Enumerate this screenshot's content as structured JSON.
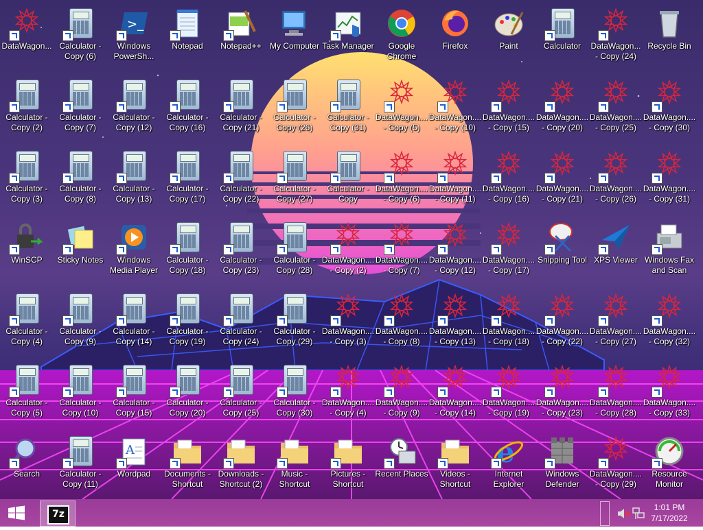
{
  "desktop": {
    "icons": [
      {
        "label": "DataWagon...",
        "type": "star"
      },
      {
        "label": "Calculator - Copy (6)",
        "type": "calc"
      },
      {
        "label": "Windows PowerSh...",
        "type": "powershell"
      },
      {
        "label": "Notepad",
        "type": "notepad"
      },
      {
        "label": "Notepad++",
        "type": "notepadpp"
      },
      {
        "label": "My Computer",
        "type": "computer"
      },
      {
        "label": "Task Manager",
        "type": "taskmgr"
      },
      {
        "label": "Google Chrome",
        "type": "chrome"
      },
      {
        "label": "Firefox",
        "type": "firefox"
      },
      {
        "label": "Paint",
        "type": "paint"
      },
      {
        "label": "Calculator",
        "type": "calc"
      },
      {
        "label": "DataWagon... - Copy (24)",
        "type": "star"
      },
      {
        "label": "Recycle Bin",
        "type": "recycle"
      },
      {
        "label": "Calculator - Copy (2)",
        "type": "calc"
      },
      {
        "label": "Calculator - Copy (7)",
        "type": "calc"
      },
      {
        "label": "Calculator - Copy (12)",
        "type": "calc"
      },
      {
        "label": "Calculator - Copy (16)",
        "type": "calc"
      },
      {
        "label": "Calculator - Copy (21)",
        "type": "calc"
      },
      {
        "label": "Calculator - Copy (26)",
        "type": "calc"
      },
      {
        "label": "Calculator - Copy (31)",
        "type": "calc"
      },
      {
        "label": "DataWagon.... - Copy (5)",
        "type": "star"
      },
      {
        "label": "DataWagon.... - Copy (10)",
        "type": "star"
      },
      {
        "label": "DataWagon.... - Copy (15)",
        "type": "star"
      },
      {
        "label": "DataWagon.... - Copy (20)",
        "type": "star"
      },
      {
        "label": "DataWagon.... - Copy (25)",
        "type": "star"
      },
      {
        "label": "DataWagon.... - Copy (30)",
        "type": "star"
      },
      {
        "label": "Calculator - Copy (3)",
        "type": "calc"
      },
      {
        "label": "Calculator - Copy (8)",
        "type": "calc"
      },
      {
        "label": "Calculator - Copy (13)",
        "type": "calc"
      },
      {
        "label": "Calculator - Copy (17)",
        "type": "calc"
      },
      {
        "label": "Calculator - Copy (22)",
        "type": "calc"
      },
      {
        "label": "Calculator - Copy (27)",
        "type": "calc"
      },
      {
        "label": "Calculator - Copy",
        "type": "calc"
      },
      {
        "label": "DataWagon.... - Copy (6)",
        "type": "star"
      },
      {
        "label": "DataWagon.... - Copy (11)",
        "type": "star"
      },
      {
        "label": "DataWagon.... - Copy (16)",
        "type": "star"
      },
      {
        "label": "DataWagon.... - Copy (21)",
        "type": "star"
      },
      {
        "label": "DataWagon.... - Copy (26)",
        "type": "star"
      },
      {
        "label": "DataWagon.... - Copy (31)",
        "type": "star"
      },
      {
        "label": "WinSCP",
        "type": "winscp"
      },
      {
        "label": "Sticky Notes",
        "type": "sticky"
      },
      {
        "label": "Windows Media Player",
        "type": "wmp"
      },
      {
        "label": "Calculator - Copy (18)",
        "type": "calc"
      },
      {
        "label": "Calculator - Copy (23)",
        "type": "calc"
      },
      {
        "label": "Calculator - Copy (28)",
        "type": "calc"
      },
      {
        "label": "DataWagon.... - Copy (2)",
        "type": "star"
      },
      {
        "label": "DataWagon.... - Copy (7)",
        "type": "star"
      },
      {
        "label": "DataWagon.... - Copy (12)",
        "type": "star"
      },
      {
        "label": "DataWagon.... - Copy (17)",
        "type": "star"
      },
      {
        "label": "Snipping Tool",
        "type": "snip"
      },
      {
        "label": "XPS Viewer",
        "type": "xps"
      },
      {
        "label": "Windows Fax and Scan",
        "type": "fax"
      },
      {
        "label": "Calculator - Copy (4)",
        "type": "calc"
      },
      {
        "label": "Calculator - Copy (9)",
        "type": "calc"
      },
      {
        "label": "Calculator - Copy (14)",
        "type": "calc"
      },
      {
        "label": "Calculator - Copy (19)",
        "type": "calc"
      },
      {
        "label": "Calculator - Copy (24)",
        "type": "calc"
      },
      {
        "label": "Calculator - Copy (29)",
        "type": "calc"
      },
      {
        "label": "DataWagon.... - Copy (3)",
        "type": "star"
      },
      {
        "label": "DataWagon.... - Copy (8)",
        "type": "star"
      },
      {
        "label": "DataWagon.... - Copy (13)",
        "type": "star"
      },
      {
        "label": "DataWagon.... - Copy (18)",
        "type": "star"
      },
      {
        "label": "DataWagon.... - Copy (22)",
        "type": "star"
      },
      {
        "label": "DataWagon.... - Copy (27)",
        "type": "star"
      },
      {
        "label": "DataWagon.... - Copy (32)",
        "type": "star"
      },
      {
        "label": "Calculator - Copy (5)",
        "type": "calc"
      },
      {
        "label": "Calculator - Copy (10)",
        "type": "calc"
      },
      {
        "label": "Calculator - Copy (15)",
        "type": "calc"
      },
      {
        "label": "Calculator - Copy (20)",
        "type": "calc"
      },
      {
        "label": "Calculator - Copy (25)",
        "type": "calc"
      },
      {
        "label": "Calculator - Copy (30)",
        "type": "calc"
      },
      {
        "label": "DataWagon.... - Copy (4)",
        "type": "star"
      },
      {
        "label": "DataWagon.... - Copy (9)",
        "type": "star"
      },
      {
        "label": "DataWagon.... - Copy (14)",
        "type": "star"
      },
      {
        "label": "DataWagon.... - Copy (19)",
        "type": "star"
      },
      {
        "label": "DataWagon.... - Copy (23)",
        "type": "star"
      },
      {
        "label": "DataWagon.... - Copy (28)",
        "type": "star"
      },
      {
        "label": "DataWagon.... - Copy (33)",
        "type": "star"
      },
      {
        "label": "Search",
        "type": "search"
      },
      {
        "label": "Calculator - Copy (11)",
        "type": "calc"
      },
      {
        "label": "Wordpad",
        "type": "wordpad"
      },
      {
        "label": "Documents - Shortcut",
        "type": "folder"
      },
      {
        "label": "Downloads - Shortcut (2)",
        "type": "folder"
      },
      {
        "label": "Music - Shortcut",
        "type": "folder"
      },
      {
        "label": "Pictures - Shortcut",
        "type": "folder"
      },
      {
        "label": "Recent Places",
        "type": "recent"
      },
      {
        "label": "Videos - Shortcut",
        "type": "folder"
      },
      {
        "label": "Internet Explorer",
        "type": "ie"
      },
      {
        "label": "Windows Defender",
        "type": "defender"
      },
      {
        "label": "DataWagon.... - Copy (29)",
        "type": "star"
      },
      {
        "label": "Resource Monitor",
        "type": "resmon"
      }
    ]
  },
  "taskbar": {
    "start_icon": "windows-logo-icon",
    "pinned_app": "7z",
    "clock_time": "1:01 PM",
    "clock_date": "7/17/2022"
  },
  "colors": {
    "taskbar": "#a545a0",
    "sun_top": "#ffd56b",
    "sun_bottom": "#e050d0",
    "grid_magenta": "#ff40ff",
    "grid_blue": "#3a5cff"
  }
}
